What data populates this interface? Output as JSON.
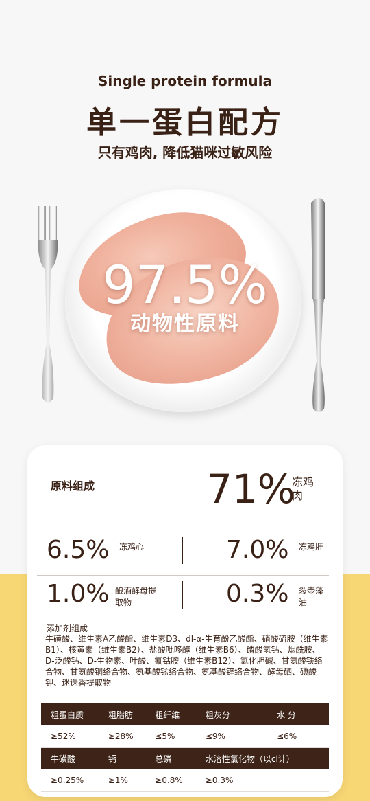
{
  "header": {
    "subtitle_en": "Single protein formula",
    "title_cn": "单一蛋白配方",
    "tagline": "只有鸡肉, 降低猫咪过敏风险"
  },
  "hero": {
    "percent": "97.5%",
    "percent_label": "动物性原料"
  },
  "composition": {
    "title": "原料组成",
    "main": {
      "percent": "71%",
      "name": "冻鸡肉"
    },
    "items": [
      {
        "percent": "6.5%",
        "name": "冻鸡心"
      },
      {
        "percent": "7.0%",
        "name": "冻鸡肝"
      },
      {
        "percent": "1.0%",
        "name": "酿酒酵母提取物"
      },
      {
        "percent": "0.3%",
        "name": "裂壶藻油"
      }
    ]
  },
  "additives": {
    "title": "添加剂组成",
    "text": "牛磺酸、维生素A乙酸酯、维生素D3、dl-α-生育酚乙酸酯、硝酸硫胺（维生素B1）、核黄素（维生素B2）、盐酸吡哆醇（维生素B6）、磷酸氢钙、烟酰胺、D-泛酸钙、D-生物素、叶酸、氰钴胺（维生素B12）、氯化胆碱、甘氨酸铁络合物、甘氨酸铜络合物、氨基酸锰络合物、氨基酸锌络合物、酵母硒、碘酸钾、迷迭香提取物"
  },
  "nutrition": {
    "row1_labels": [
      "粗蛋白质",
      "粗脂肪",
      "粗纤维",
      "粗灰分",
      "水 分"
    ],
    "row1_values": [
      "≥52%",
      "≥28%",
      "≤5%",
      "≤9%",
      "≤6%"
    ],
    "row2_labels": [
      "牛磺酸",
      "钙",
      "总磷",
      "水溶性氯化物（以cl计）"
    ],
    "row2_values": [
      "≥0.25%",
      "≥1%",
      "≥0.8%",
      "≥0.3%"
    ]
  }
}
